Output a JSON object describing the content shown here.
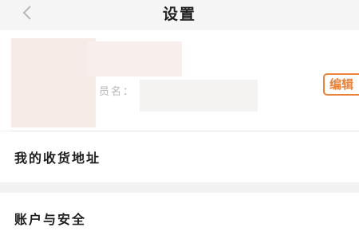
{
  "header": {
    "title": "设置",
    "back_icon": "chevron-left-icon"
  },
  "profile": {
    "member_label": "员名：",
    "edit_label": "编辑",
    "accent_color": "#e8823c"
  },
  "settings": {
    "address_label": "我的收货地址",
    "security_label": "账户与安全"
  }
}
